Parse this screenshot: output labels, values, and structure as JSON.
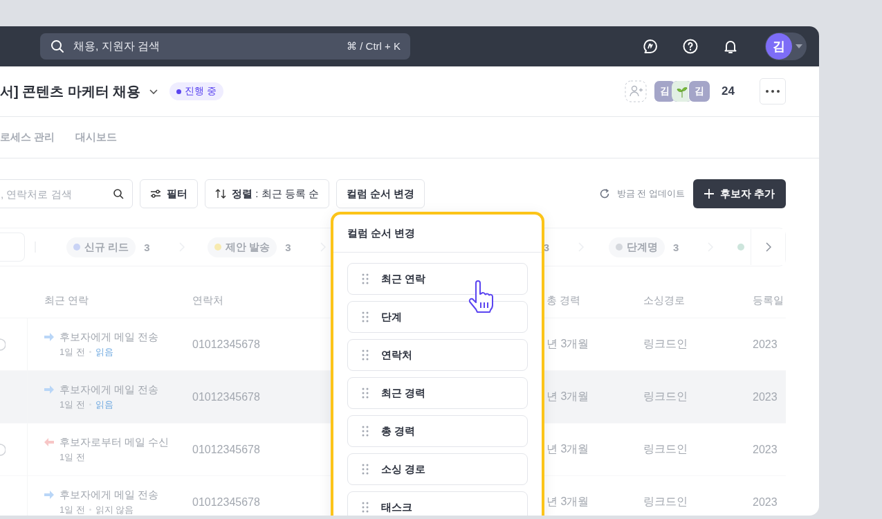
{
  "topbar": {
    "search": {
      "placeholder": "채용, 지원자 검색",
      "shortcut": "⌘ / Ctrl + K"
    },
    "avatar": "김"
  },
  "header": {
    "title": "서] 콘텐츠 마케터 채용",
    "status": "진행 중",
    "members": [
      {
        "kind": "initial",
        "label": "김"
      },
      {
        "kind": "sprout"
      },
      {
        "kind": "initial",
        "label": "김"
      }
    ],
    "member_count": "24"
  },
  "tabs": [
    {
      "label": "로세스 관리",
      "selected": false
    },
    {
      "label": "대시보드",
      "selected": false
    }
  ],
  "toolbar": {
    "search_placeholder": ", 연락처로 검색",
    "filter": "필터",
    "sort": "**정렬** : 최근 등록 순",
    "column_order": "컬럼 순서 변경",
    "updated": "방금 전 업데이트",
    "add": "후보자 추가"
  },
  "stages": [
    {
      "name": "신규 리드",
      "count": "3",
      "color": "#c9d3f5"
    },
    {
      "name": "제안 발송",
      "count": "3",
      "color": "#f7eab0"
    },
    {
      "count": "3"
    },
    {
      "name": "단계명",
      "count": "3",
      "color": "#d5d8dd"
    },
    {
      "color": "#cde5dc"
    }
  ],
  "table": {
    "columns": {
      "last_contact": "최근 연락",
      "contact": "연락처",
      "total_career": "총 경력",
      "source": "소싱경로",
      "registered": "등록일"
    },
    "rows": [
      {
        "marker": true,
        "selected": false,
        "kind": "sent",
        "message": "후보자에게 메일 전송",
        "time": "1일 전",
        "read_label": "읽음",
        "read": true,
        "contact": "01012345678",
        "total_career": "년 3개월",
        "source": "링크드인",
        "registered": "2023"
      },
      {
        "marker": false,
        "selected": true,
        "kind": "sent",
        "message": "후보자에게 메일 전송",
        "time": "1일 전",
        "read_label": "읽음",
        "read": true,
        "contact": "01012345678",
        "total_career": "년 3개월",
        "source": "링크드인",
        "registered": "2023"
      },
      {
        "marker": true,
        "selected": false,
        "kind": "received",
        "message": "후보자로부터 메일 수신",
        "time": "1일 전",
        "contact": "01012345678",
        "total_career": "년 3개월",
        "source": "링크드인",
        "registered": "2023"
      },
      {
        "marker": false,
        "selected": false,
        "kind": "sent",
        "message": "후보자에게 메일 전송",
        "time": "1일 전",
        "read_label": "읽지 않음",
        "read": false,
        "contact": "01012345678",
        "total_career": "년 3개월",
        "source": "링크드인",
        "registered": "2023"
      }
    ]
  },
  "popup": {
    "title": "컬럼 순서 변경",
    "items": [
      "최근 연락",
      "단계",
      "연락처",
      "최근 경력",
      "총 경력",
      "소싱 경로",
      "태스크"
    ]
  }
}
